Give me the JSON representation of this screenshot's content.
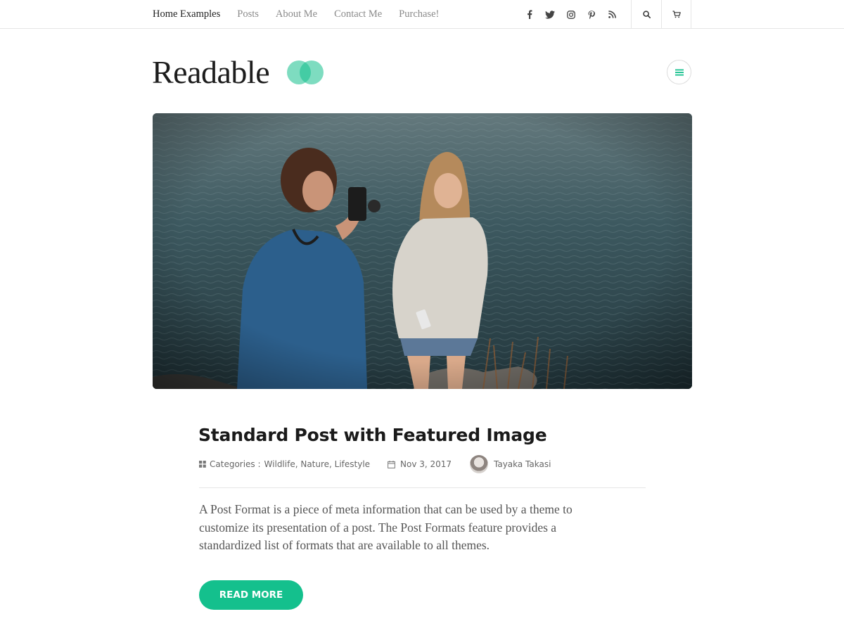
{
  "topnav": {
    "items": [
      {
        "label": "Home Examples"
      },
      {
        "label": "Posts"
      },
      {
        "label": "About Me"
      },
      {
        "label": "Contact Me"
      },
      {
        "label": "Purchase!"
      }
    ]
  },
  "social": {
    "icons": [
      "facebook-icon",
      "twitter-icon",
      "instagram-icon",
      "pinterest-icon",
      "rss-icon"
    ]
  },
  "header": {
    "brand": "Readable",
    "accent_color": "#14c08d"
  },
  "post": {
    "title": "Standard Post with Featured Image",
    "categories_label": "Categories :",
    "categories": "Wildlife, Nature, Lifestyle",
    "date": "Nov 3, 2017",
    "author": "Tayaka Takasi",
    "excerpt": "A Post Format is a piece of meta information that can be used by a theme to customize its presentation of a post. The Post Formats feature provides a standardized list of formats that are available to all themes.",
    "read_more": "READ MORE"
  }
}
